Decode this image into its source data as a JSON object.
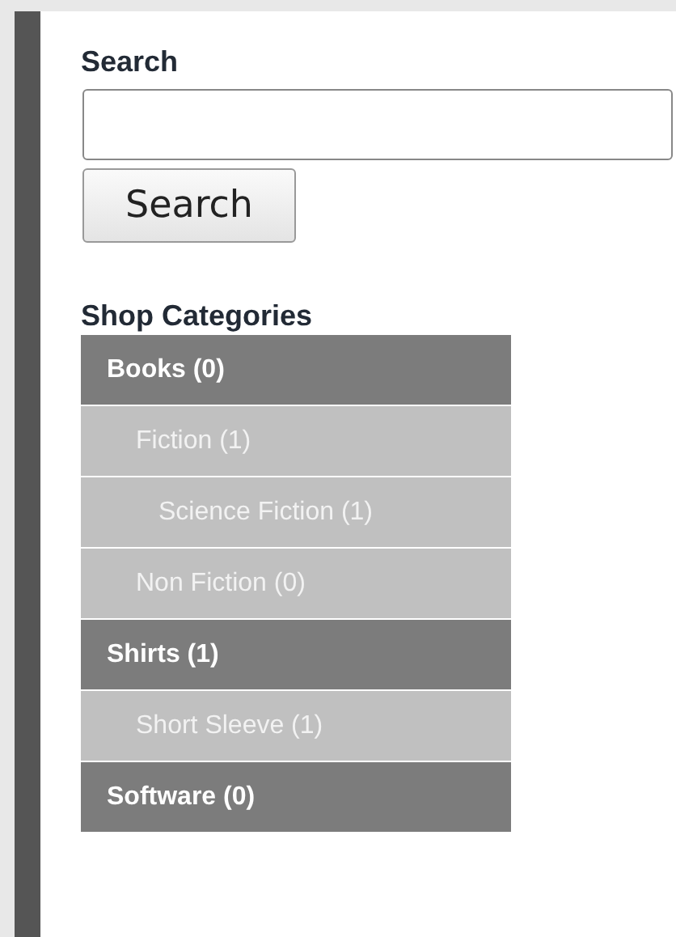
{
  "search": {
    "heading": "Search",
    "button": "Search"
  },
  "categories": {
    "heading": "Shop Categories",
    "items": [
      {
        "label": "Books (0)",
        "children": [
          {
            "label": "Fiction (1)",
            "children": [
              {
                "label": "Science Fiction (1)"
              }
            ]
          },
          {
            "label": "Non Fiction (0)"
          }
        ]
      },
      {
        "label": "Shirts (1)",
        "children": [
          {
            "label": "Short Sleeve (1)"
          }
        ]
      },
      {
        "label": "Software (0)"
      }
    ]
  }
}
